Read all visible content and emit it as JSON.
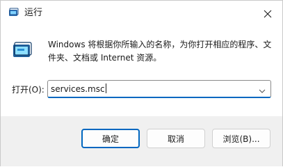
{
  "window": {
    "title": "运行"
  },
  "dialog": {
    "description": "Windows 将根据你所输入的名称，为你打开相应的程序、文件夹、文档或 Internet 资源。",
    "open_label": "打开(O):",
    "open_value": "services.msc"
  },
  "buttons": {
    "ok": "确定",
    "cancel": "取消",
    "browse": "浏览(B)..."
  },
  "colors": {
    "accent": "#0067c0",
    "footer_bg": "#f0f0f0"
  },
  "icons": {
    "title": "run-app-icon",
    "close": "close-icon",
    "main": "run-app-icon",
    "dropdown": "chevron-down-icon"
  }
}
